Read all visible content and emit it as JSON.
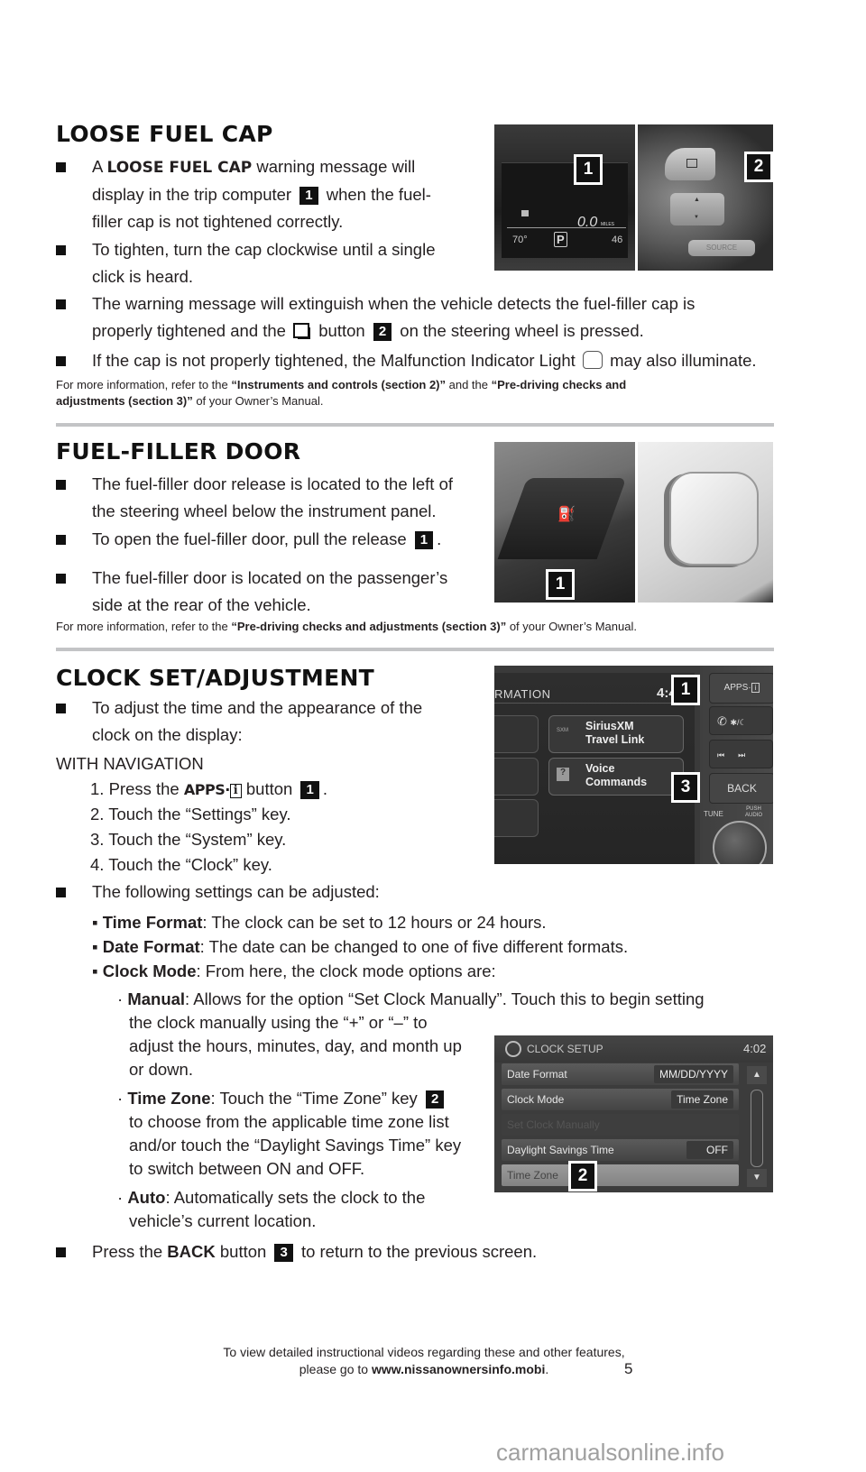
{
  "page_number": "5",
  "watermark": "carmanualsonline.info",
  "footer": {
    "line1": "To view detailed instructional videos regarding these and other features,",
    "line2_prefix": "please go to ",
    "url": "www.nissanownersinfo.mobi",
    "line2_suffix": "."
  },
  "loose_fuel_cap": {
    "title": "LOOSE FUEL CAP",
    "bullets": [
      {
        "pre": "A ",
        "bold": "LOOSE FUEL CAP",
        "l1": " warning message will",
        "l2a": "display in the trip computer ",
        "tag": "1",
        "l2b": " when the fuel-",
        "l3": "filler cap is not tightened correctly."
      },
      {
        "l1": "To tighten, turn the cap clockwise until a single",
        "l2": "click is heard."
      },
      {
        "l1": "The warning message will extinguish when the vehicle detects the fuel-filler cap is",
        "l2a": "properly tightened and the ",
        "l2b": " button ",
        "tag": "2",
        "l2c": " on the steering wheel is pressed."
      },
      {
        "l1a": "If the cap is not properly tightened, the Malfunction Indicator Light ",
        "l1b": " may also illuminate."
      }
    ],
    "ref": {
      "pre": "For more information, refer to the ",
      "b1": "“Instruments and controls (section 2)”",
      "mid": " and the ",
      "b2": "“Pre-driving checks and",
      "b2b": "adjustments (section 3)”",
      "post": " of your Owner’s Manual."
    },
    "photo1": {
      "tag": "1",
      "miles": "0.0",
      "miles_unit": "MILES",
      "temp": "70°",
      "gear": "P",
      "right": "46"
    },
    "photo2": {
      "tag": "2",
      "source": "SOURCE"
    }
  },
  "fuel_filler_door": {
    "title": "FUEL-FILLER DOOR",
    "bullets": [
      {
        "l1": "The fuel-filler door release is located to the left of",
        "l2": "the steering wheel below the instrument panel."
      },
      {
        "l1a": "To open the fuel-filler door, pull the release ",
        "tag": "1",
        "l1b": "."
      },
      {
        "l1": "The fuel-filler door is located on the passenger’s",
        "l2": "side at the rear of the vehicle."
      }
    ],
    "ref": {
      "pre": "For more information, refer to the ",
      "b1": "“Pre-driving checks and adjustments (section 3)”",
      "post": " of your Owner’s Manual."
    },
    "photo1": {
      "tag": "1"
    }
  },
  "clock": {
    "title": "CLOCK SET/ADJUSTMENT",
    "intro": {
      "l1": "To adjust the time and the appearance of the",
      "l2": "clock on the display:"
    },
    "with_nav": "WITH NAVIGATION",
    "steps": [
      {
        "pre": "1. Press the ",
        "apps": "APPS·",
        "apps_i": "i",
        "post": " button ",
        "tag": "1",
        "end": "."
      },
      {
        "text": "2. Touch the “Settings” key."
      },
      {
        "text": "3. Touch the “System” key."
      },
      {
        "text": "4. Touch the “Clock” key."
      }
    ],
    "settings_intro": "The following settings can be adjusted:",
    "settings": [
      {
        "bold": "Time Format",
        "text": ": The clock can be set to 12 hours or 24 hours."
      },
      {
        "bold": "Date Format",
        "text": ": The date can be changed to one of five different formats."
      },
      {
        "bold": "Clock Mode",
        "text": ": From here, the clock mode options are:"
      }
    ],
    "modes": {
      "manual": {
        "bold": "Manual",
        "l1": ": Allows for the option “Set Clock Manually”. Touch this to begin setting",
        "l2": "the clock manually using the “+” or “–” to",
        "l3": "adjust the hours, minutes, day, and month up",
        "l4": "or down."
      },
      "time_zone": {
        "bold": "Time Zone",
        "l1": ": Touch the “Time Zone” key ",
        "tag": "2",
        "l2": "to choose from the applicable time zone list",
        "l3": "and/or touch the “Daylight Savings Time” key",
        "l4": "to switch between ON and OFF."
      },
      "auto": {
        "bold": "Auto",
        "l1": ": Automatically sets the clock to the",
        "l2": "vehicle’s current location."
      }
    },
    "back": {
      "pre": "Press the ",
      "bold": "BACK",
      "mid": " button ",
      "tag": "3",
      "post": " to return to the previous screen."
    },
    "screen1": {
      "header": "RMATION",
      "time": "4:48",
      "tiles": [
        {
          "l1": "SiriusXM",
          "l2": "Travel Link"
        },
        {
          "l1": "Voice",
          "l2": "Commands"
        }
      ],
      "buttons": {
        "apps": "APPS·",
        "back": "BACK",
        "tune": "TUNE",
        "push_audio_1": "PUSH",
        "push_audio_2": "AUDIO"
      },
      "tag1": "1",
      "tag3": "3"
    },
    "screen2": {
      "title": "CLOCK SETUP",
      "time": "4:02",
      "rows": [
        {
          "label": "Date Format",
          "value": "MM/DD/YYYY"
        },
        {
          "label": "Clock Mode",
          "value": "Time Zone"
        },
        {
          "label": "Set Clock Manually",
          "value": ""
        },
        {
          "label": "Daylight Savings Time",
          "value": "OFF"
        },
        {
          "label": "Time Zone",
          "value": ""
        }
      ],
      "tag2": "2"
    }
  }
}
